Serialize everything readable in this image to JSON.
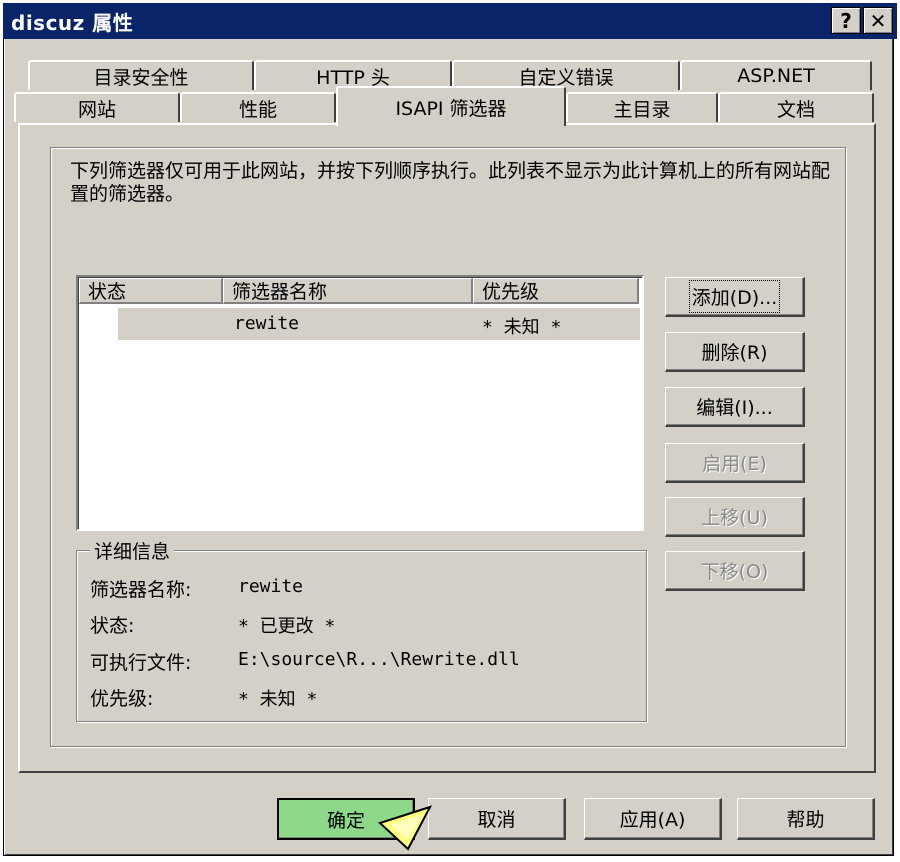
{
  "window": {
    "title": "discuz 属性",
    "help_glyph": "?",
    "close_glyph": "✕"
  },
  "tabs": {
    "row_back": [
      "目录安全性",
      "HTTP 头",
      "自定义错误",
      "ASP.NET"
    ],
    "row_front": [
      "网站",
      "性能",
      "ISAPI 筛选器",
      "主目录",
      "文档"
    ],
    "active": "ISAPI 筛选器"
  },
  "description": "下列筛选器仅可用于此网站，并按下列顺序执行。此列表不显示为此计算机上的所有网站配置的筛选器。",
  "list": {
    "columns": [
      "状态",
      "筛选器名称",
      "优先级"
    ],
    "rows": [
      {
        "status": "",
        "name": "rewite",
        "priority": "* 未知 *"
      }
    ]
  },
  "side_buttons": [
    {
      "label": "添加(D)...",
      "enabled": true
    },
    {
      "label": "删除(R)",
      "enabled": true
    },
    {
      "label": "编辑(I)...",
      "enabled": true
    },
    {
      "label": "启用(E)",
      "enabled": false
    },
    {
      "label": "上移(U)",
      "enabled": false
    },
    {
      "label": "下移(O)",
      "enabled": false
    }
  ],
  "details": {
    "title": "详细信息",
    "rows": [
      {
        "label": "筛选器名称:",
        "value": "rewite"
      },
      {
        "label": "状态:",
        "value": "* 已更改 *"
      },
      {
        "label": "可执行文件:",
        "value": "E:\\source\\R...\\Rewrite.dll"
      },
      {
        "label": "优先级:",
        "value": "* 未知 *"
      }
    ]
  },
  "dialog_buttons": {
    "ok": "确定",
    "cancel": "取消",
    "apply": "应用(A)",
    "help": "帮助"
  },
  "colors": {
    "title_bar": "#0a246a",
    "face": "#d4d0c8",
    "ok_highlight": "#8ed88a"
  }
}
